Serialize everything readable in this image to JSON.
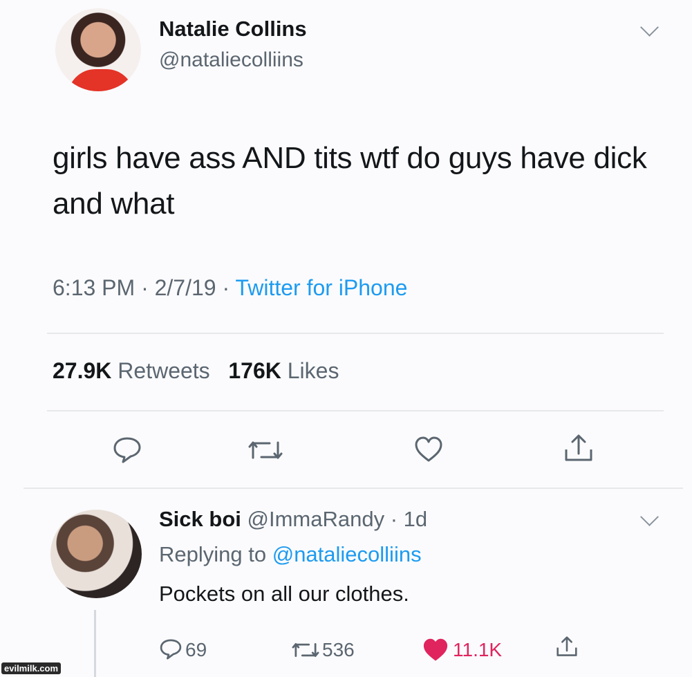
{
  "tweet": {
    "author_name": "Natalie Collins",
    "author_handle": "@nataliecolliins",
    "text": "girls have ass AND tits wtf do guys have dick and what",
    "time": "6:13 PM",
    "separator": "·",
    "date": "2/7/19",
    "source": "Twitter for iPhone",
    "retweets_count": "27.9K",
    "retweets_label": "Retweets",
    "likes_count": "176K",
    "likes_label": "Likes",
    "actions": [
      "reply-icon",
      "retweet-icon",
      "like-icon",
      "share-icon"
    ]
  },
  "reply": {
    "author_name": "Sick boi",
    "author_handle": "@ImmaRandy",
    "separator": "·",
    "age": "1d",
    "replying_prefix": "Replying to",
    "replying_to": "@nataliecolliins",
    "text": "Pockets on all our clothes.",
    "reply_count": "69",
    "retweet_count": "536",
    "like_count": "11.1K",
    "liked": true
  },
  "watermark": "evilmilk.com",
  "colors": {
    "link": "#1d9bf0",
    "secondary": "#5b6670",
    "like": "#e0245e",
    "background": "#fbfbfd"
  }
}
